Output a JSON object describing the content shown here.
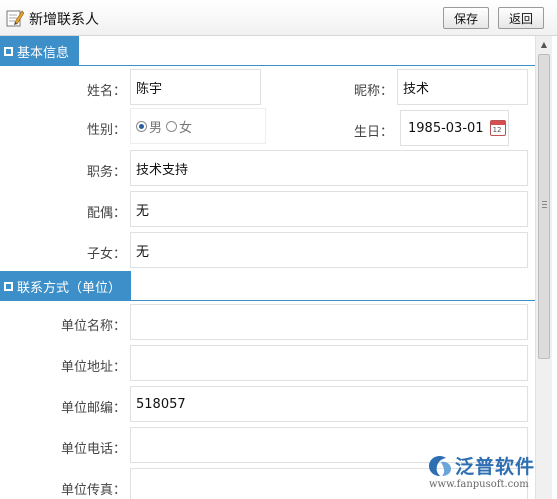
{
  "window": {
    "title": "新增联系人",
    "save_label": "保存",
    "back_label": "返回"
  },
  "sections": {
    "basic": {
      "title": "基本信息"
    },
    "contact": {
      "title": "联系方式（单位）"
    }
  },
  "basic": {
    "name_label": "姓名：",
    "name_value": "陈宇",
    "nickname_label": "昵称：",
    "nickname_value": "技术",
    "gender_label": "性别：",
    "gender_male": "男",
    "gender_female": "女",
    "gender_selected": "男",
    "birthday_label": "生日：",
    "birthday_value": "1985-03-01",
    "position_label": "职务：",
    "position_value": "技术支持",
    "spouse_label": "配偶：",
    "spouse_value": "无",
    "children_label": "子女：",
    "children_value": "无"
  },
  "contact": {
    "company_name_label": "单位名称：",
    "company_name_value": "",
    "company_address_label": "单位地址：",
    "company_address_value": "",
    "postcode_label": "单位邮编：",
    "postcode_value": "518057",
    "phone_label": "单位电话：",
    "phone_value": "",
    "fax_label": "单位传真：",
    "fax_value": ""
  },
  "watermark": {
    "brand": "泛普软件",
    "url": "www.fanpusoft.com"
  },
  "icons": {
    "title": "notepad-pencil-icon",
    "birthday": "calendar-icon",
    "section": "collapse-box-icon"
  },
  "colors": {
    "section_blue": "#3c8fc8",
    "watermark_blue": "#2d6fb2"
  }
}
